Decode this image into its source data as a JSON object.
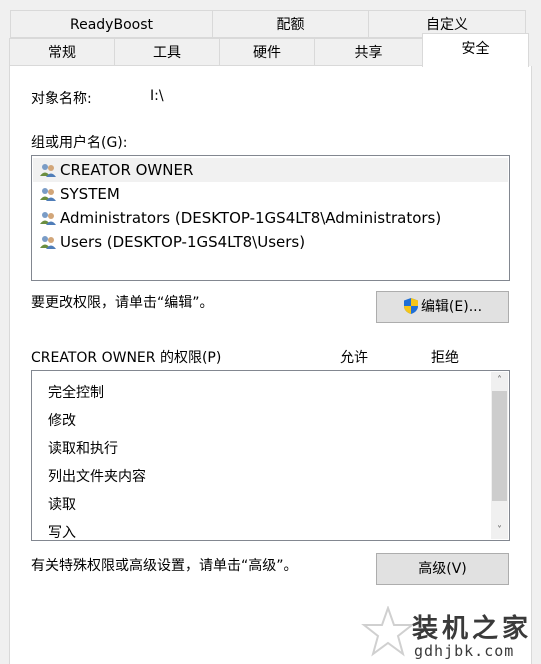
{
  "tabs": {
    "row1": [
      "ReadyBoost",
      "配额",
      "自定义"
    ],
    "row2": [
      "常规",
      "工具",
      "硬件",
      "共享"
    ],
    "active": "安全"
  },
  "object": {
    "label": "对象名称:",
    "value": "I:\\"
  },
  "groups": {
    "label": "组或用户名(G):",
    "items": [
      "CREATOR OWNER",
      "SYSTEM",
      "Administrators (DESKTOP-1GS4LT8\\Administrators)",
      "Users (DESKTOP-1GS4LT8\\Users)"
    ]
  },
  "edit": {
    "hint": "要更改权限，请单击“编辑”。",
    "button": "编辑(E)..."
  },
  "permissions": {
    "label": "CREATOR OWNER 的权限(P)",
    "allow": "允许",
    "deny": "拒绝",
    "items": [
      "完全控制",
      "修改",
      "读取和执行",
      "列出文件夹内容",
      "读取",
      "写入"
    ]
  },
  "advanced": {
    "hint": "有关特殊权限或高级设置，请单击“高级”。",
    "button": "高级(V)"
  },
  "watermark": {
    "text": "装机之家",
    "url": "gdhjbk.com"
  },
  "colors": {
    "selection": "#f1f1f1",
    "list_border": "#828790",
    "button_bg": "#e1e1e1"
  },
  "icons": {
    "group": "users-icon",
    "edit": "shield-icon",
    "watermark": "star-icon"
  }
}
